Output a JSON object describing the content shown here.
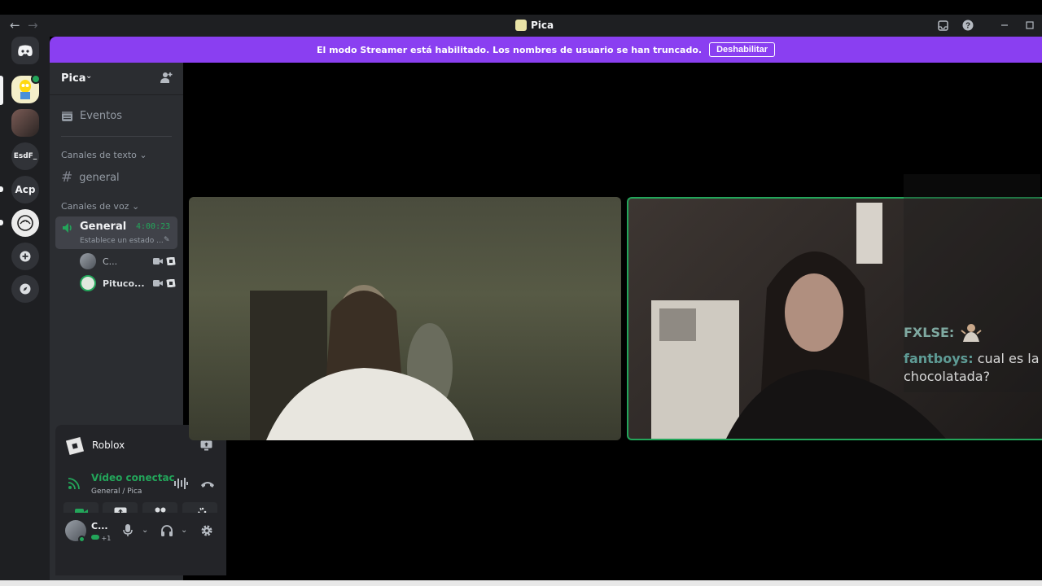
{
  "window": {
    "title": "Pica",
    "back_icon": "arrow-left-icon",
    "forward_icon": "arrow-right-icon",
    "controls": [
      "inbox-icon",
      "help-icon",
      "minimize-icon",
      "maximize-icon"
    ]
  },
  "banner": {
    "message": "El modo Streamer está habilitado. Los nombres de usuario se han truncado.",
    "button": "Deshabilitar",
    "color": "#8a3ff1"
  },
  "servers": [
    {
      "label": "",
      "icon": "discord-logo-icon"
    },
    {
      "label": "",
      "icon": "server-pica-icon"
    },
    {
      "label": "",
      "icon": "server-avatar-icon"
    },
    {
      "label": "EsdF_",
      "icon": ""
    },
    {
      "label": "Acp",
      "icon": ""
    },
    {
      "label": "",
      "icon": "server-sketch-icon"
    },
    {
      "label": "",
      "icon": "add-server-icon"
    },
    {
      "label": "",
      "icon": "explore-icon"
    }
  ],
  "sidebar": {
    "guild_name": "Pica",
    "events_label": "Eventos",
    "text_category": "Canales de texto",
    "text_channel": "general",
    "voice_category": "Canales de voz",
    "voice_channel": {
      "name": "General",
      "timer": "4:00:23",
      "status": "Establece un estado ..."
    },
    "members": [
      {
        "name": "C..."
      },
      {
        "name": "Pituco..."
      }
    ]
  },
  "activity": {
    "game": "Roblox",
    "connection_title": "Vídeo conectac",
    "connection_sub": "General / Pica",
    "buttons": [
      "camera-icon",
      "screen-share-icon",
      "activities-icon",
      "soundboard-icon"
    ]
  },
  "user_panel": {
    "name": "C...",
    "tag": "+1"
  },
  "chat_overlay": {
    "line1_user": "FXLSE",
    "line2_user": "fantboys",
    "line2_text": "cual es la chocolatada?"
  },
  "colors": {
    "accent_green": "#23a55a",
    "rail": "#1e1f22",
    "sidebar": "#2b2d31"
  }
}
